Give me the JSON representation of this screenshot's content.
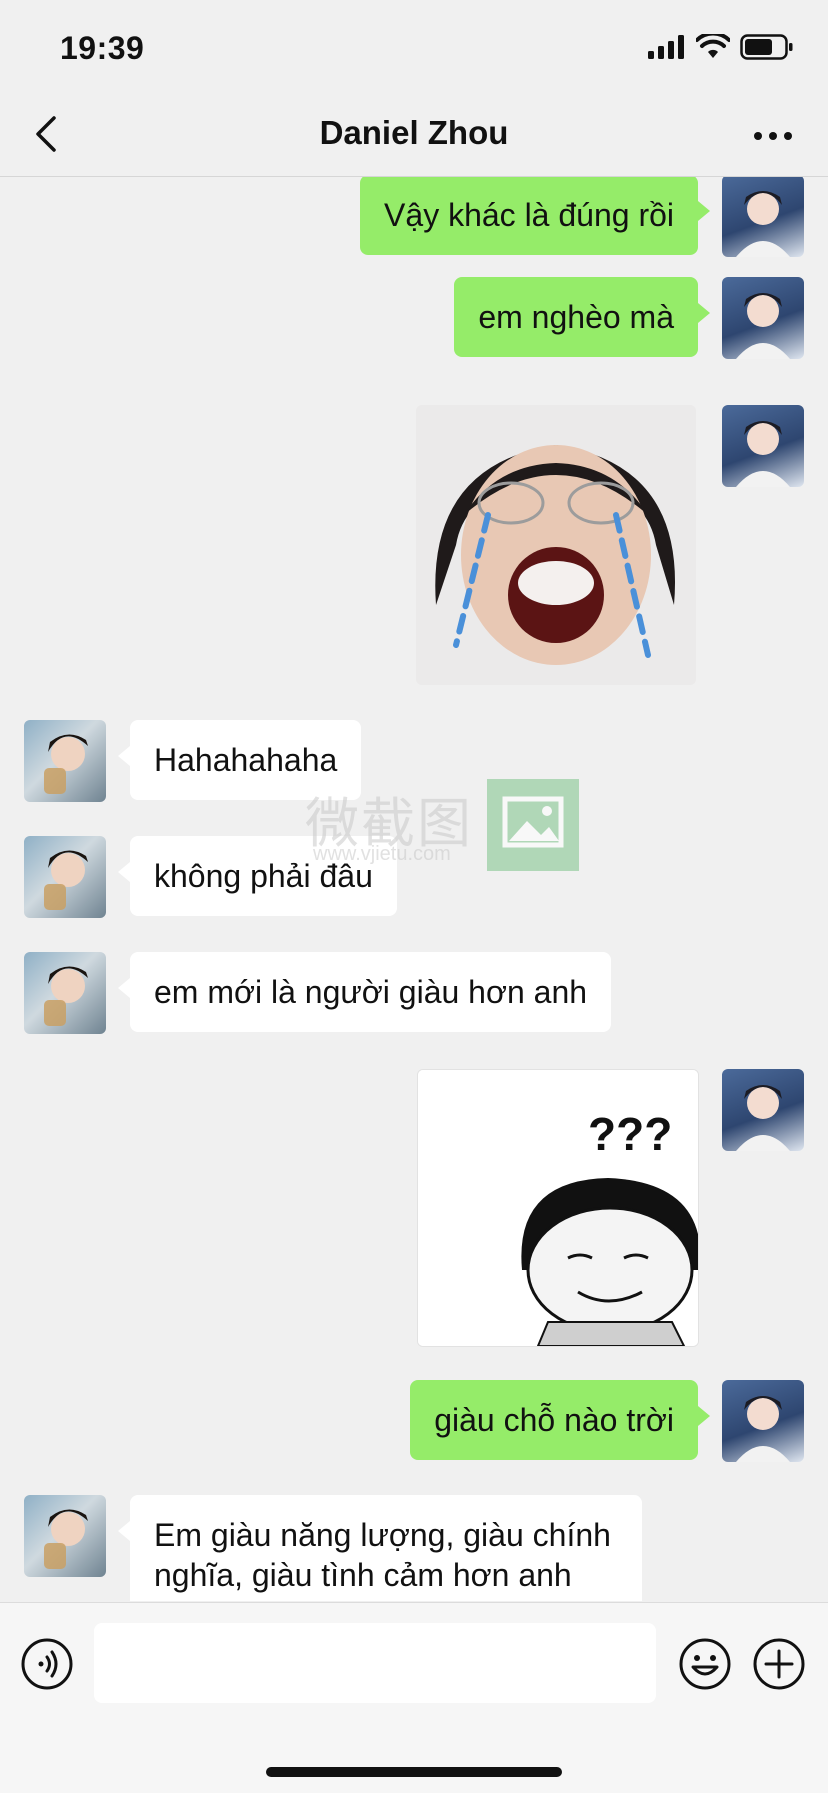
{
  "status_bar": {
    "time": "19:39"
  },
  "header": {
    "title": "Daniel Zhou"
  },
  "messages": [
    {
      "from": "me",
      "type": "text",
      "text": "Vậy khác là đúng rồi"
    },
    {
      "from": "me",
      "type": "text",
      "text": "em nghèo mà"
    },
    {
      "from": "me",
      "type": "sticker",
      "sticker": "crying-face-sticker"
    },
    {
      "from": "other",
      "type": "text",
      "text": "Hahahahaha"
    },
    {
      "from": "other",
      "type": "text",
      "text": "không phải đâu"
    },
    {
      "from": "other",
      "type": "text",
      "text": "em mới là người giàu hơn anh"
    },
    {
      "from": "me",
      "type": "sticker",
      "sticker": "confused-question-mark-sticker",
      "caption": "???"
    },
    {
      "from": "me",
      "type": "text",
      "text": "giàu chỗ nào trời"
    },
    {
      "from": "other",
      "type": "text",
      "text": "Em giàu năng lượng, giàu chính nghĩa, giàu tình cảm hơn anh"
    }
  ],
  "watermark": {
    "text": "微截图",
    "url": "www.vjietu.com"
  },
  "colors": {
    "my_bubble": "#95ec69",
    "other_bubble": "#ffffff",
    "background": "#f0f0f0"
  }
}
